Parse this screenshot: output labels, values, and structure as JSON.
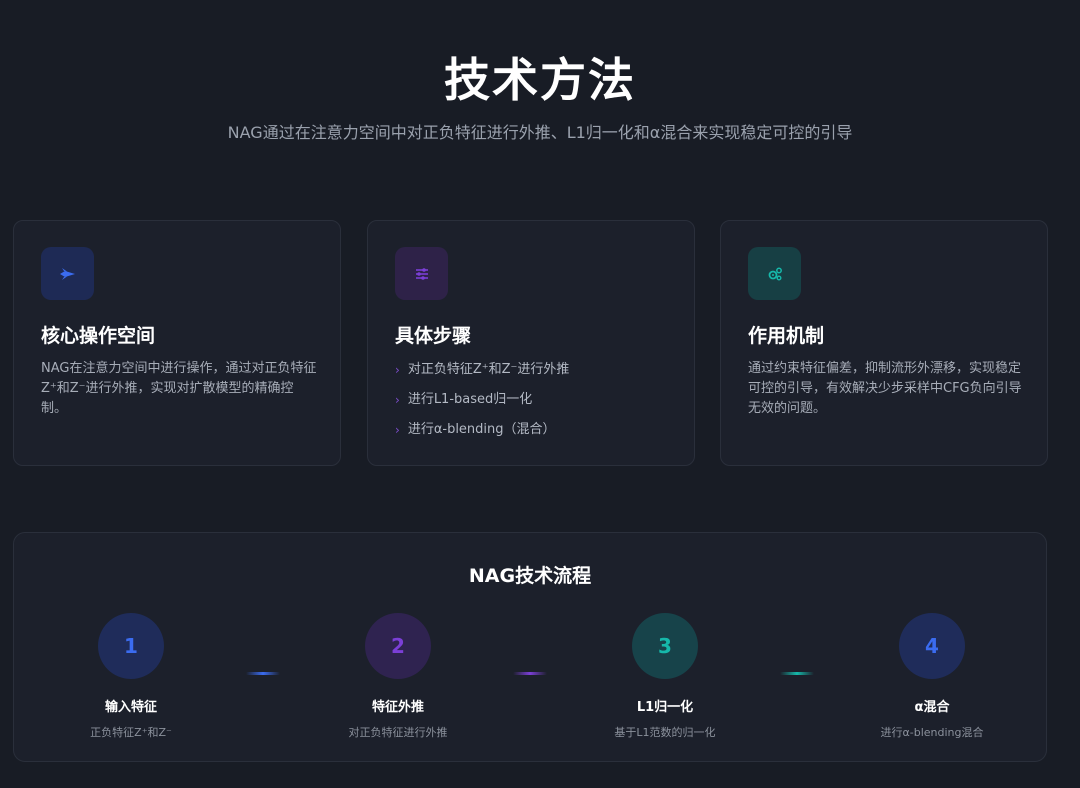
{
  "header": {
    "title": "技术方法",
    "subtitle": "NAG通过在注意力空间中对正负特征进行外推、L1归一化和α混合来实现稳定可控的引导"
  },
  "colors": {
    "background": "#181c25",
    "card": "#1c202b",
    "blue": "#3b6cf0",
    "purple": "#7b3fd6",
    "teal": "#16b8aa"
  },
  "cards": [
    {
      "icon": "rocket-icon",
      "title": "核心操作空间",
      "description": "NAG在注意力空间中进行操作，通过对正负特征Z⁺和Z⁻进行外推，实现对扩散模型的精确控制。"
    },
    {
      "icon": "sliders-icon",
      "title": "具体步骤",
      "steps": [
        "对正负特征Z⁺和Z⁻进行外推",
        "进行L1-based归一化",
        "进行α-blending（混合）"
      ]
    },
    {
      "icon": "gears-icon",
      "title": "作用机制",
      "description": "通过约束特征偏差，抑制流形外漂移，实现稳定可控的引导，有效解决少步采样中CFG负向引导无效的问题。"
    }
  ],
  "flow": {
    "title": "NAG技术流程",
    "steps": [
      {
        "number": "1",
        "label": "输入特征",
        "sub": "正负特征Z⁺和Z⁻"
      },
      {
        "number": "2",
        "label": "特征外推",
        "sub": "对正负特征进行外推"
      },
      {
        "number": "3",
        "label": "L1归一化",
        "sub": "基于L1范数的归一化"
      },
      {
        "number": "4",
        "label": "α混合",
        "sub": "进行α-blending混合"
      }
    ]
  }
}
